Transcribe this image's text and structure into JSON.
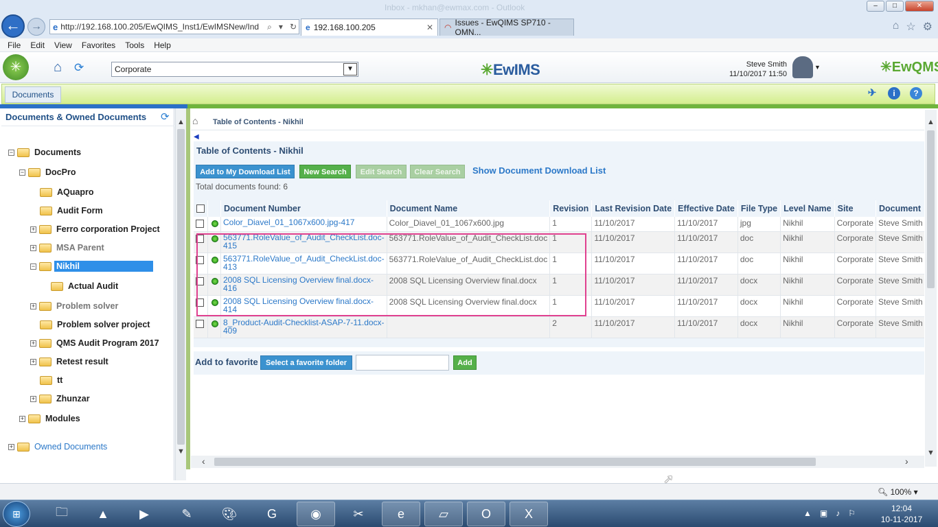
{
  "browser": {
    "window_title": "Inbox - mkhan@ewmax.com - Outlook",
    "address": "http://192.168.100.205/EwQIMS_Inst1/EwIMSNew/Ind",
    "tabs": [
      {
        "label": "192.168.100.205",
        "active": true
      },
      {
        "label": "Issues - EwQIMS SP710 - OMN...",
        "active": false
      }
    ],
    "menu": [
      "File",
      "Edit",
      "View",
      "Favorites",
      "Tools",
      "Help"
    ]
  },
  "app": {
    "site_select": "Corporate",
    "brand_center": "EwIMS",
    "brand_right": "EwQMS",
    "user_name": "Steve Smith",
    "user_datetime": "11/10/2017 11:50",
    "module_tab": "Documents"
  },
  "left_panel": {
    "title": "Documents & Owned Documents",
    "tree": [
      {
        "label": "Documents",
        "toggle": "−"
      },
      {
        "label": "DocPro",
        "toggle": "−"
      },
      {
        "label": "AQuapro",
        "toggle": ""
      },
      {
        "label": "Audit Form",
        "toggle": ""
      },
      {
        "label": "Ferro corporation Project",
        "toggle": "+"
      },
      {
        "label": "MSA Parent",
        "toggle": "+"
      },
      {
        "label": "Nikhil",
        "toggle": "−"
      },
      {
        "label": "Actual Audit",
        "toggle": ""
      },
      {
        "label": "Problem solver",
        "toggle": "+"
      },
      {
        "label": "Problem solver project",
        "toggle": ""
      },
      {
        "label": "QMS Audit Program 2017",
        "toggle": "+"
      },
      {
        "label": "Retest result",
        "toggle": "+"
      },
      {
        "label": "tt",
        "toggle": ""
      },
      {
        "label": "Zhunzar",
        "toggle": "+"
      },
      {
        "label": "Modules",
        "toggle": "+"
      },
      {
        "label": "Owned Documents",
        "toggle": "+"
      }
    ]
  },
  "main": {
    "breadcrumb": "Table of Contents - Nikhil",
    "section_title": "Table of Contents - Nikhil",
    "buttons": {
      "add_download": "Add to My Download List",
      "new_search": "New Search",
      "edit_search": "Edit Search",
      "clear_search": "Clear Search",
      "show_download": "Show Document Download List"
    },
    "total_found": "Total documents found: 6",
    "columns": [
      "Document Number",
      "Document Name",
      "Revision",
      "Last Revision Date",
      "Effective Date",
      "File Type",
      "Level Name",
      "Site",
      "Document"
    ],
    "rows": [
      {
        "number": "Color_Diavel_01_1067x600.jpg-417",
        "name": "Color_Diavel_01_1067x600.jpg",
        "revision": "1",
        "last_rev": "11/10/2017",
        "effective": "11/10/2017",
        "type": "jpg",
        "level": "Nikhil",
        "site": "Corporate",
        "owner": "Steve Smith"
      },
      {
        "number": "563771.RoleValue_of_Audit_CheckList.doc-415",
        "name": "563771.RoleValue_of_Audit_CheckList.doc",
        "revision": "1",
        "last_rev": "11/10/2017",
        "effective": "11/10/2017",
        "type": "doc",
        "level": "Nikhil",
        "site": "Corporate",
        "owner": "Steve Smith"
      },
      {
        "number": "563771.RoleValue_of_Audit_CheckList.doc-413",
        "name": "563771.RoleValue_of_Audit_CheckList.doc",
        "revision": "1",
        "last_rev": "11/10/2017",
        "effective": "11/10/2017",
        "type": "doc",
        "level": "Nikhil",
        "site": "Corporate",
        "owner": "Steve Smith"
      },
      {
        "number": "2008 SQL Licensing Overview final.docx-416",
        "name": "2008 SQL Licensing Overview final.docx",
        "revision": "1",
        "last_rev": "11/10/2017",
        "effective": "11/10/2017",
        "type": "docx",
        "level": "Nikhil",
        "site": "Corporate",
        "owner": "Steve Smith"
      },
      {
        "number": "2008 SQL Licensing Overview final.docx-414",
        "name": "2008 SQL Licensing Overview final.docx",
        "revision": "1",
        "last_rev": "11/10/2017",
        "effective": "11/10/2017",
        "type": "docx",
        "level": "Nikhil",
        "site": "Corporate",
        "owner": "Steve Smith"
      },
      {
        "number": "8_Product-Audit-Checklist-ASAP-7-11.docx-409",
        "name": "",
        "revision": "2",
        "last_rev": "11/10/2017",
        "effective": "11/10/2017",
        "type": "docx",
        "level": "Nikhil",
        "site": "Corporate",
        "owner": "Steve Smith"
      }
    ],
    "favorite": {
      "label": "Add to favorite",
      "select_button": "Select a favorite folder",
      "input_value": "",
      "add_button": "Add"
    }
  },
  "status": {
    "zoom": "100%"
  },
  "taskbar": {
    "time": "12:04",
    "date": "10-11-2017"
  },
  "colors": {
    "accent_blue": "#2b78c8",
    "accent_green": "#55b04a",
    "highlight_pink": "#e0408f",
    "selection": "#2e8fe8"
  }
}
